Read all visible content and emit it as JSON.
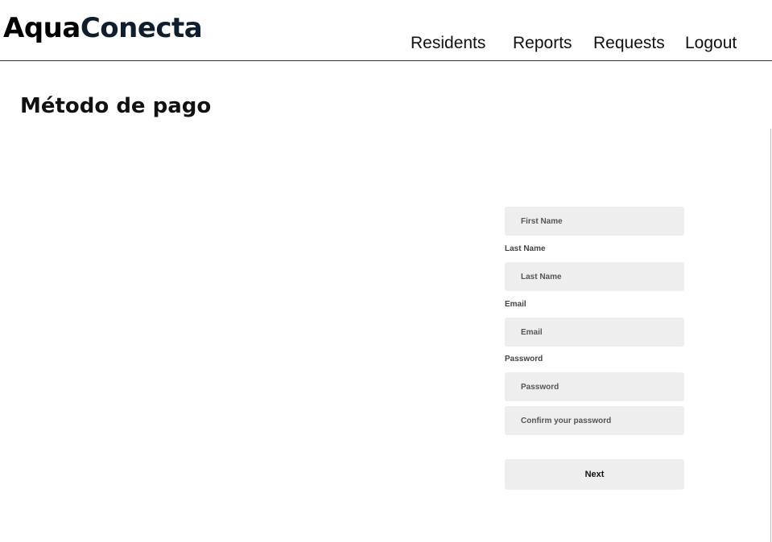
{
  "header": {
    "logo": {
      "part_a": "Aqua",
      "part_b": "Conecta"
    },
    "nav": {
      "residents": "Residents",
      "reports": "Reports",
      "requests": "Requests",
      "logout": "Logout"
    }
  },
  "main": {
    "title": "Método de pago"
  },
  "form": {
    "first_name": {
      "placeholder": "First Name"
    },
    "last_name": {
      "label": "Last Name",
      "placeholder": "Last Name"
    },
    "email": {
      "label": "Email",
      "placeholder": "Email"
    },
    "password": {
      "label": "Password",
      "placeholder": "Password"
    },
    "confirm_password": {
      "placeholder": "Confirm your password"
    },
    "next_label": "Next"
  },
  "colors": {
    "field_bg": "#eeeeee",
    "header_rule": "#333333",
    "logo_dark": "#0f1e2e"
  }
}
